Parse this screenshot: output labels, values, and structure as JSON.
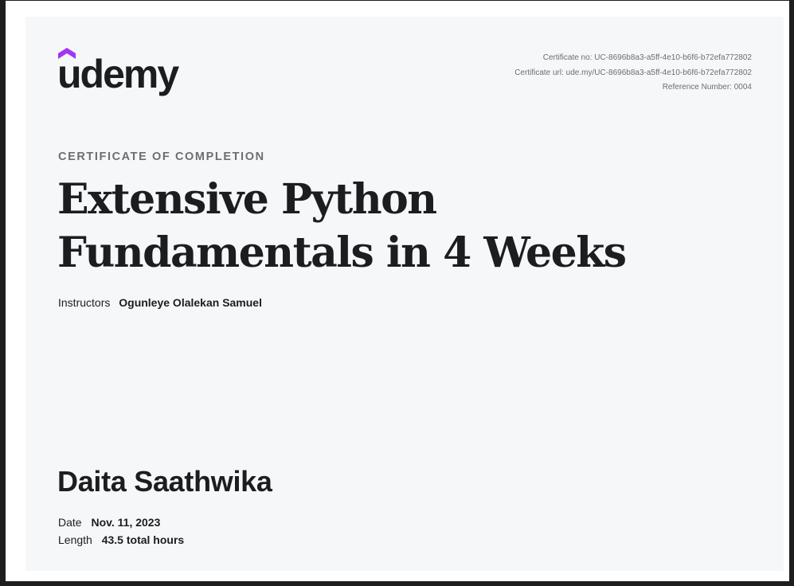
{
  "brand": {
    "name": "udemy",
    "logo_icon": "graduation-hat-icon",
    "accent_color": "#a435f0"
  },
  "certificate": {
    "number_line": "Certificate no: UC-8696b8a3-a5ff-4e10-b6f6-b72efa772802",
    "url_line": "Certificate url: ude.my/UC-8696b8a3-a5ff-4e10-b6f6-b72efa772802",
    "reference_line": "Reference Number: 0004",
    "kicker": "CERTIFICATE OF COMPLETION",
    "course_title_line1": "Extensive Python",
    "course_title_line2": "Fundamentals in 4 Weeks",
    "instructors_label": "Instructors",
    "instructors_value": "Ogunleye Olalekan Samuel",
    "recipient": "Daita Saathwika",
    "date_label": "Date",
    "date_value": "Nov. 11, 2023",
    "length_label": "Length",
    "length_value": "43.5 total hours"
  }
}
